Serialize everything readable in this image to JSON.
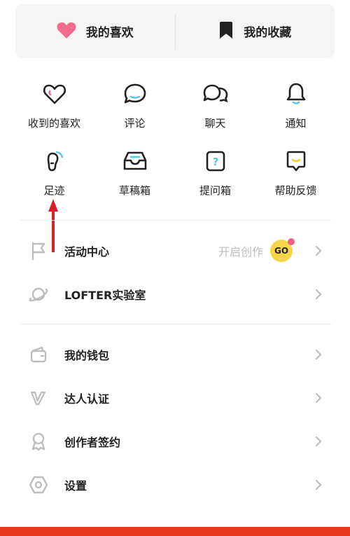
{
  "top_card": {
    "likes_label": "我的喜欢",
    "favorites_label": "我的收藏"
  },
  "grid": {
    "items": [
      {
        "label": "收到的喜欢",
        "icon": "heart-icon"
      },
      {
        "label": "评论",
        "icon": "comment-icon"
      },
      {
        "label": "聊天",
        "icon": "chat-icon"
      },
      {
        "label": "通知",
        "icon": "bell-icon"
      },
      {
        "label": "足迹",
        "icon": "footprint-icon"
      },
      {
        "label": "草稿箱",
        "icon": "drafts-icon"
      },
      {
        "label": "提问箱",
        "icon": "question-box-icon"
      },
      {
        "label": "帮助反馈",
        "icon": "feedback-icon"
      }
    ]
  },
  "menu": {
    "activity": {
      "label": "活动中心",
      "extra": "开启创作",
      "badge": "GO",
      "icon": "flag-icon"
    },
    "lab": {
      "label": "LOFTER实验室",
      "icon": "planet-icon"
    },
    "wallet": {
      "label": "我的钱包",
      "icon": "wallet-icon"
    },
    "verify": {
      "label": "达人认证",
      "icon": "v-badge-icon"
    },
    "contract": {
      "label": "创作者签约",
      "icon": "ribbon-icon"
    },
    "settings": {
      "label": "设置",
      "icon": "gear-icon"
    }
  },
  "colors": {
    "heart": "#f06d8f",
    "accent_teal": "#5ac8e0",
    "badge_yellow": "#f7d54a",
    "badge_dot": "#f0608a",
    "annotation_arrow": "#d9212a",
    "bottom_bar": "#e6391f"
  }
}
